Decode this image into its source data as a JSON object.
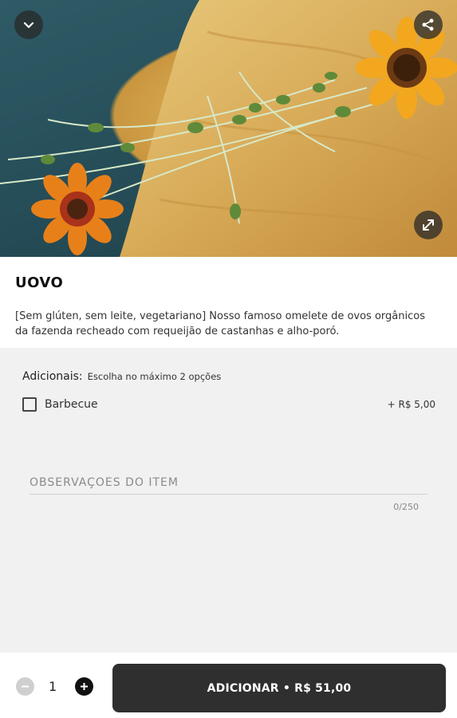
{
  "hero": {
    "image_alt": "Omelete com brotos e flores",
    "icons": {
      "collapse": "chevron-down-icon",
      "share": "share-icon",
      "expand": "expand-icon"
    }
  },
  "product": {
    "title": "UOVO",
    "description": "[Sem glúten, sem leite, vegetariano] Nosso famoso omelete de ovos orgânicos da fazenda recheado com requeijão de castanhas e alho-poró."
  },
  "extras": {
    "label": "Adicionais:",
    "hint": "Escolha no máximo 2 opções",
    "options": [
      {
        "label": "Barbecue",
        "price": "+ R$ 5,00",
        "checked": false
      }
    ]
  },
  "notes": {
    "placeholder": "OBSERVAÇÕES DO ITEM",
    "value": "",
    "counter": "0/250"
  },
  "footer": {
    "quantity": "1",
    "add_button": "ADICIONAR • R$ 51,00"
  },
  "colors": {
    "button_dark": "#2f2f2f",
    "options_bg": "#f1f1f1",
    "plate_teal": "#27505b",
    "omelette": "#d9ad55",
    "flower_orange": "#f0a21e"
  }
}
